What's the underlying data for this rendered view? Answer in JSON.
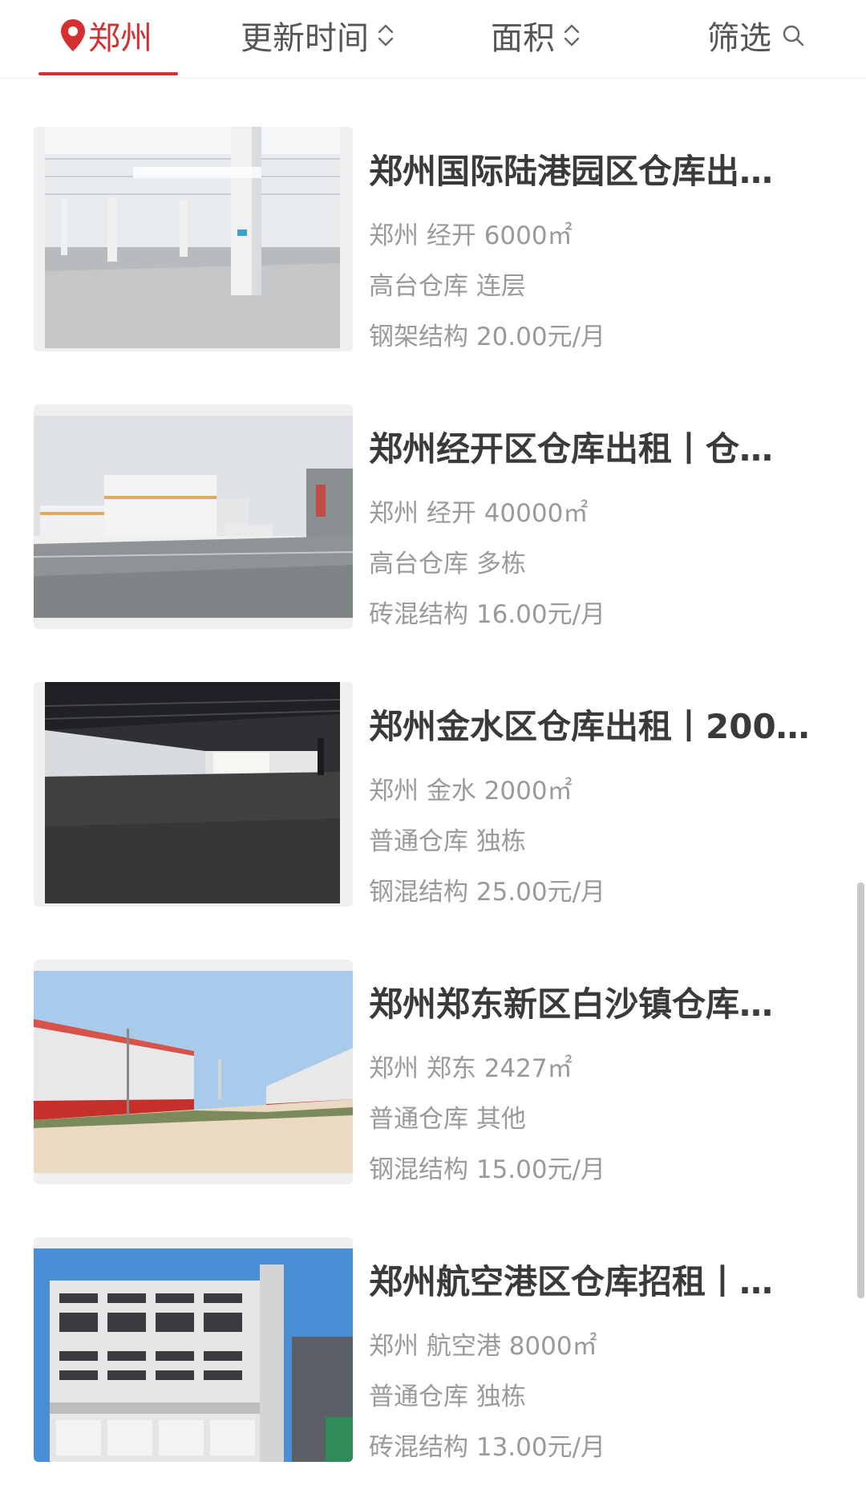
{
  "filter_bar": {
    "city": "郑州",
    "sort_update": "更新时间",
    "sort_area": "面积",
    "screen": "筛选",
    "accent_color": "#d43030"
  },
  "listings": [
    {
      "title": "郑州国际陆港园区仓库出…",
      "location_area": "郑州 经开 6000㎡",
      "type": "高台仓库 连层",
      "structure_price": "钢架结构 20.00元/月",
      "image": "warehouse-interior-white-steel-columns"
    },
    {
      "title": "郑州经开区仓库出租丨仓…",
      "location_area": "郑州 经开 40000㎡",
      "type": "高台仓库 多栋",
      "structure_price": "砖混结构 16.00元/月",
      "image": "warehouse-complex-exterior-parking-lot"
    },
    {
      "title": "郑州金水区仓库出租丨200…",
      "location_area": "郑州 金水 2000㎡",
      "type": "普通仓库 独栋",
      "structure_price": "钢混结构 25.00元/月",
      "image": "dark-warehouse-interior"
    },
    {
      "title": "郑州郑东新区白沙镇仓库…",
      "location_area": "郑州 郑东 2427㎡",
      "type": "普通仓库 其他",
      "structure_price": "钢混结构 15.00元/月",
      "image": "warehouse-row-red-stripe-road"
    },
    {
      "title": "郑州航空港区仓库招租丨…",
      "location_area": "郑州 航空港 8000㎡",
      "type": "普通仓库 独栋",
      "structure_price": "砖混结构 13.00元/月",
      "image": "multi-storey-warehouse-building"
    }
  ]
}
